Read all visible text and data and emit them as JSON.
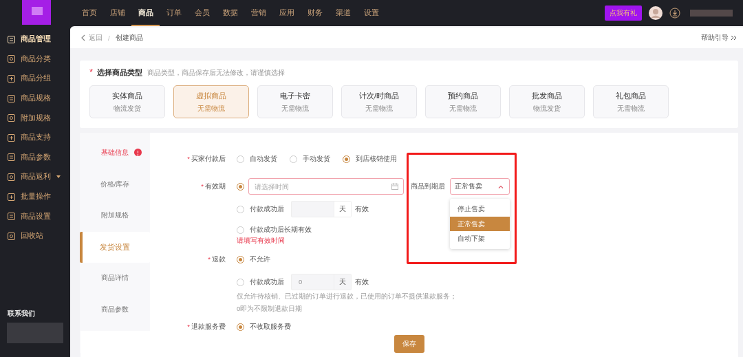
{
  "top_nav": {
    "items": [
      {
        "label": "首页",
        "selected": false
      },
      {
        "label": "店铺",
        "selected": false
      },
      {
        "label": "商品",
        "selected": true
      },
      {
        "label": "订单",
        "selected": false
      },
      {
        "label": "会员",
        "selected": false
      },
      {
        "label": "数据",
        "selected": false
      },
      {
        "label": "营销",
        "selected": false
      },
      {
        "label": "应用",
        "selected": false
      },
      {
        "label": "财务",
        "selected": false
      },
      {
        "label": "渠道",
        "selected": false
      },
      {
        "label": "设置",
        "selected": false
      }
    ],
    "gift_button": "点我有礼"
  },
  "sidebar": {
    "items": [
      {
        "label": "商品管理",
        "selected": true,
        "expandable": false
      },
      {
        "label": "商品分类",
        "selected": false,
        "expandable": false
      },
      {
        "label": "商品分组",
        "selected": false,
        "expandable": false
      },
      {
        "label": "商品规格",
        "selected": false,
        "expandable": false
      },
      {
        "label": "附加规格",
        "selected": false,
        "expandable": false
      },
      {
        "label": "商品支持",
        "selected": false,
        "expandable": false
      },
      {
        "label": "商品参数",
        "selected": false,
        "expandable": false
      },
      {
        "label": "商品返利",
        "selected": false,
        "expandable": true
      },
      {
        "label": "批量操作",
        "selected": false,
        "expandable": false
      },
      {
        "label": "商品设置",
        "selected": false,
        "expandable": false
      },
      {
        "label": "回收站",
        "selected": false,
        "expandable": false
      }
    ],
    "contact_title": "联系我们"
  },
  "breadcrumb": {
    "back": "返回",
    "separator": "/",
    "current": "创建商品",
    "help": "帮助引导"
  },
  "product_type": {
    "title": "选择商品类型",
    "required_mark": "*",
    "hint": "商品类型，商品保存后无法修改，请谨慎选择",
    "options": [
      {
        "name": "实体商品",
        "sub": "物流发货",
        "selected": false
      },
      {
        "name": "虚拟商品",
        "sub": "无需物流",
        "selected": true
      },
      {
        "name": "电子卡密",
        "sub": "无需物流",
        "selected": false
      },
      {
        "name": "计次/时商品",
        "sub": "无需物流",
        "selected": false
      },
      {
        "name": "预约商品",
        "sub": "无需物流",
        "selected": false
      },
      {
        "name": "批发商品",
        "sub": "物流发货",
        "selected": false
      },
      {
        "name": "礼包商品",
        "sub": "无需物流",
        "selected": false
      }
    ]
  },
  "form_tabs": [
    {
      "label": "基础信息",
      "selected": false,
      "error": true
    },
    {
      "label": "价格/库存",
      "selected": false,
      "error": false
    },
    {
      "label": "附加规格",
      "selected": false,
      "error": false
    },
    {
      "label": "发货设置",
      "selected": true,
      "error": false
    },
    {
      "label": "商品详情",
      "selected": false,
      "error": false
    },
    {
      "label": "商品参数",
      "selected": false,
      "error": false
    }
  ],
  "delivery": {
    "label": "买家付款后",
    "required_mark": "*",
    "options": [
      {
        "label": "自动发货",
        "selected": false
      },
      {
        "label": "手动发货",
        "selected": false
      },
      {
        "label": "到店核销使用",
        "selected": true
      }
    ]
  },
  "validity": {
    "label": "有效期",
    "required_mark": "*",
    "choices": [
      {
        "kind": "date",
        "selected": true,
        "placeholder": "请选择时间"
      },
      {
        "kind": "days",
        "selected": false,
        "prefix": "付款成功后",
        "unit": "天",
        "suffix": "有效"
      },
      {
        "kind": "plain",
        "selected": false,
        "label": "付款成功后长期有效"
      }
    ],
    "error": "请填写有效时间",
    "expiry": {
      "label": "商品到期后",
      "value": "正常售卖",
      "expanded": true,
      "options": [
        {
          "label": "停止售卖",
          "selected": false
        },
        {
          "label": "正常售卖",
          "selected": true
        },
        {
          "label": "自动下架",
          "selected": false
        }
      ]
    }
  },
  "refund": {
    "label": "退款",
    "required_mark": "*",
    "choices": [
      {
        "kind": "plain",
        "selected": true,
        "label": "不允许"
      },
      {
        "kind": "days",
        "selected": false,
        "prefix": "付款成功后",
        "value": "0",
        "unit": "天",
        "suffix": "有效"
      }
    ],
    "hints": [
      "仅允许待核销、已过期的订单进行退款，已使用的订单不提供退款服务；",
      "0即为不限制退款日期"
    ]
  },
  "fee": {
    "label": "退款服务费",
    "required_mark": "*",
    "choices": [
      {
        "selected": true,
        "label": "不收取服务费"
      }
    ]
  },
  "save_button": "保存"
}
